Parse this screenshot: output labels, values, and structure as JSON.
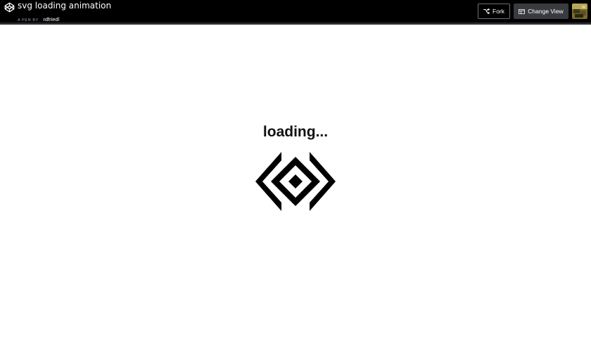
{
  "header": {
    "title": "svg loading animation",
    "byline_prefix": "A PEN BY",
    "author": "rdfriedl"
  },
  "actions": {
    "fork_label": "Fork",
    "change_view_label": "Change View"
  },
  "icons": {
    "logo": "codepen-logo-icon",
    "fork": "fork-icon",
    "change_view": "change-view-icon"
  },
  "colors": {
    "header_bg": "#000000",
    "page_bg": "#ffffff",
    "loader": "#000000"
  },
  "main": {
    "loading_text": "loading..."
  }
}
